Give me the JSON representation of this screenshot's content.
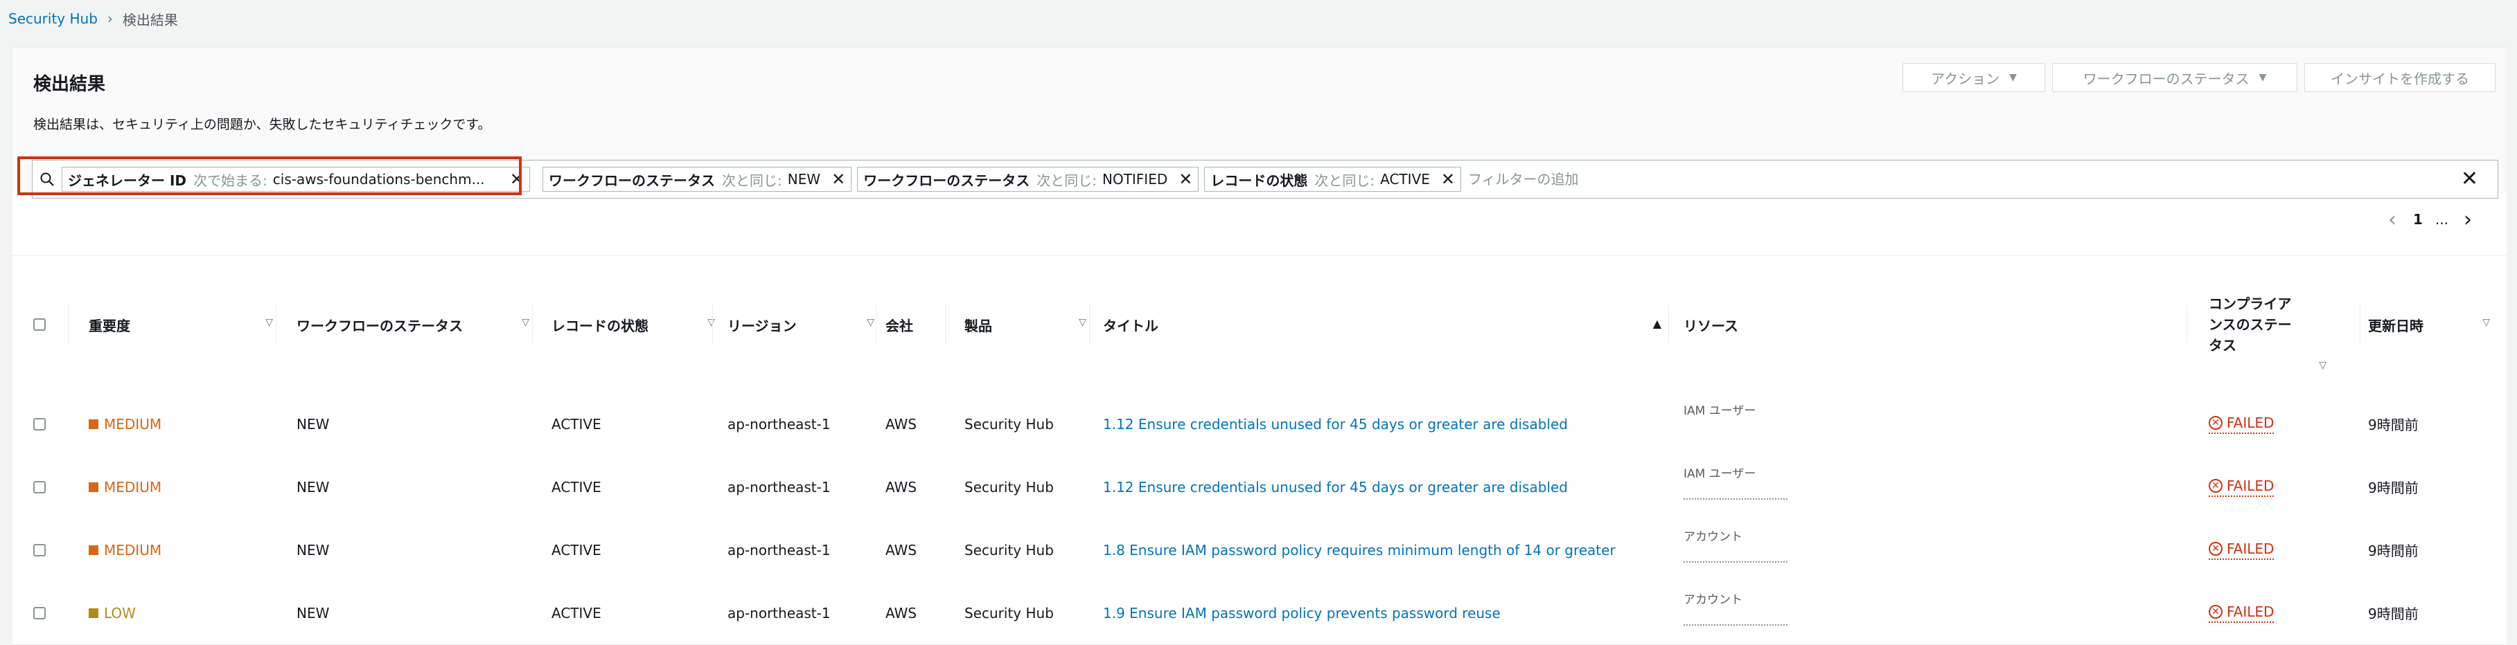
{
  "breadcrumb": {
    "root": "Security Hub",
    "current": "検出結果"
  },
  "page": {
    "title": "検出結果",
    "description": "検出結果は、セキュリティ上の問題か、失敗したセキュリティチェックです。"
  },
  "header_buttons": {
    "actions": "アクション",
    "workflow_status": "ワークフローのステータス",
    "create_insight": "インサイトを作成する"
  },
  "filters": [
    {
      "key": "ジェネレーター ID",
      "op": "次で始まる:",
      "value": "cis-aws-foundations-benchm..."
    },
    {
      "key": "ワークフローのステータス",
      "op": "次と同じ:",
      "value": "NEW"
    },
    {
      "key": "ワークフローのステータス",
      "op": "次と同じ:",
      "value": "NOTIFIED"
    },
    {
      "key": "レコードの状態",
      "op": "次と同じ:",
      "value": "ACTIVE"
    }
  ],
  "filter_placeholder": "フィルターの追加",
  "pagination": {
    "page": "1",
    "ellipsis": "..."
  },
  "columns": {
    "severity": "重要度",
    "workflow_status": "ワークフローのステータス",
    "record_state": "レコードの状態",
    "region": "リージョン",
    "company": "会社",
    "product": "製品",
    "title": "タイトル",
    "resource": "リソース",
    "compliance_line1": "コンプライア",
    "compliance_line2": "ンスのステー",
    "compliance_line3": "タス",
    "updated": "更新日時"
  },
  "colors": {
    "medium": "#d86613",
    "low": "#b38b16",
    "failed": "#d13212",
    "link": "#0073bb"
  },
  "rows": [
    {
      "severity": "MEDIUM",
      "workflow": "NEW",
      "record": "ACTIVE",
      "region": "ap-northeast-1",
      "company": "AWS",
      "product": "Security Hub",
      "title": "1.12 Ensure credentials unused for 45 days or greater are disabled",
      "resource_type": "IAM ユーザー",
      "compliance": "FAILED",
      "updated": "9時間前"
    },
    {
      "severity": "MEDIUM",
      "workflow": "NEW",
      "record": "ACTIVE",
      "region": "ap-northeast-1",
      "company": "AWS",
      "product": "Security Hub",
      "title": "1.12 Ensure credentials unused for 45 days or greater are disabled",
      "resource_type": "IAM ユーザー",
      "compliance": "FAILED",
      "updated": "9時間前"
    },
    {
      "severity": "MEDIUM",
      "workflow": "NEW",
      "record": "ACTIVE",
      "region": "ap-northeast-1",
      "company": "AWS",
      "product": "Security Hub",
      "title": "1.8 Ensure IAM password policy requires minimum length of 14 or greater",
      "resource_type": "アカウント",
      "compliance": "FAILED",
      "updated": "9時間前"
    },
    {
      "severity": "LOW",
      "workflow": "NEW",
      "record": "ACTIVE",
      "region": "ap-northeast-1",
      "company": "AWS",
      "product": "Security Hub",
      "title": "1.9 Ensure IAM password policy prevents password reuse",
      "resource_type": "アカウント",
      "compliance": "FAILED",
      "updated": "9時間前"
    }
  ]
}
